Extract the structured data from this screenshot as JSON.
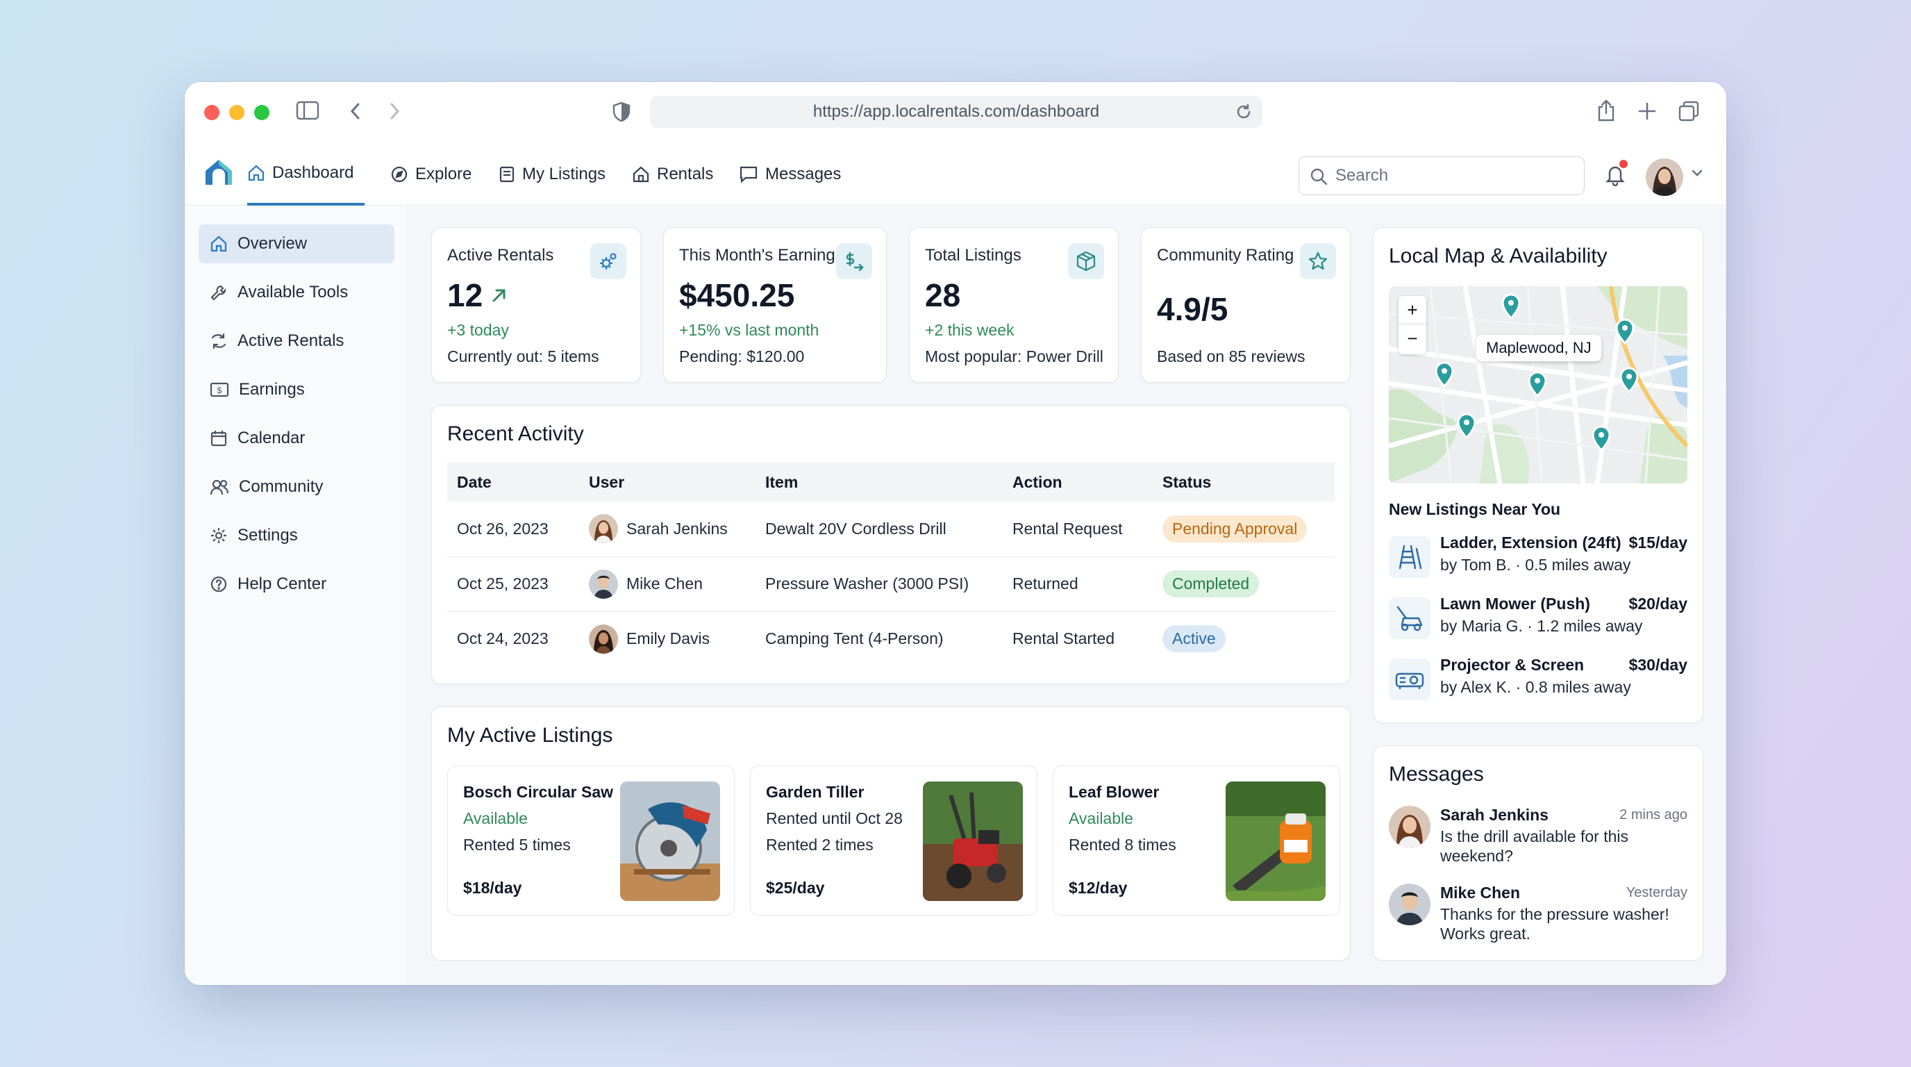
{
  "browser": {
    "url": "https://app.localrentals.com/dashboard"
  },
  "nav": {
    "items": [
      {
        "label": "Dashboard",
        "icon": "home-icon"
      },
      {
        "label": "Explore",
        "icon": "compass-icon"
      },
      {
        "label": "My Listings",
        "icon": "list-icon"
      },
      {
        "label": "Rentals",
        "icon": "house-icon"
      },
      {
        "label": "Messages",
        "icon": "chat-icon"
      }
    ],
    "search_placeholder": "Search"
  },
  "sidebar": {
    "items": [
      {
        "label": "Overview"
      },
      {
        "label": "Available Tools"
      },
      {
        "label": "Active Rentals"
      },
      {
        "label": "Earnings"
      },
      {
        "label": "Calendar"
      },
      {
        "label": "Community"
      },
      {
        "label": "Settings"
      },
      {
        "label": "Help Center"
      }
    ]
  },
  "stats": [
    {
      "label": "Active Rentals",
      "value": "12",
      "sub1": "+3 today",
      "sub2": "Currently out: 5 items"
    },
    {
      "label": "This Month's Earnings",
      "value": "$450.25",
      "sub1": "+15% vs last month",
      "sub2": "Pending: $120.00"
    },
    {
      "label": "Total Listings",
      "value": "28",
      "sub1": "+2 this week",
      "sub2": "Most popular: Power Drill"
    },
    {
      "label": "Community Rating",
      "value": "4.9/5",
      "sub2": "Based on 85 reviews"
    }
  ],
  "activity": {
    "title": "Recent Activity",
    "columns": [
      "Date",
      "User",
      "Item",
      "Action",
      "Status"
    ],
    "rows": [
      {
        "date": "Oct 26, 2023",
        "user": "Sarah Jenkins",
        "item": "Dewalt 20V Cordless Drill",
        "action": "Rental Request",
        "status": "Pending Approval"
      },
      {
        "date": "Oct 25, 2023",
        "user": "Mike Chen",
        "item": "Pressure Washer (3000 PSI)",
        "action": "Returned",
        "status": "Completed"
      },
      {
        "date": "Oct 24, 2023",
        "user": "Emily Davis",
        "item": "Camping Tent (4-Person)",
        "action": "Rental Started",
        "status": "Active"
      }
    ],
    "status_colors": {
      "Pending Approval": "#fce8cf",
      "Completed": "#d7f1dc",
      "Active": "#dbe9f7"
    }
  },
  "listings": {
    "title": "My Active Listings",
    "items": [
      {
        "name": "Bosch Circular Saw",
        "status": "Available",
        "rented": "Rented 5 times",
        "price": "$18/day"
      },
      {
        "name": "Garden Tiller",
        "status": "Rented until Oct 28",
        "rented": "Rented 2 times",
        "price": "$25/day"
      },
      {
        "name": "Leaf Blower",
        "status": "Available",
        "rented": "Rented 8 times",
        "price": "$12/day"
      }
    ]
  },
  "map": {
    "title": "Local Map & Availability",
    "tooltip": "Maplewood, NJ",
    "zoom_in": "+",
    "zoom_out": "−",
    "new_listings_title": "New Listings Near You",
    "new_listings": [
      {
        "name": "Ladder, Extension (24ft)",
        "meta": "by Tom B. · 0.5 miles away",
        "price": "$15/day",
        "icon": "ladder-icon"
      },
      {
        "name": "Lawn Mower (Push)",
        "meta": "by Maria G. · 1.2 miles away",
        "price": "$20/day",
        "icon": "lawn-mower-icon"
      },
      {
        "name": "Projector & Screen",
        "meta": "by Alex K. · 0.8 miles away",
        "price": "$30/day",
        "icon": "projector-icon"
      }
    ]
  },
  "messages": {
    "title": "Messages",
    "items": [
      {
        "name": "Sarah Jenkins",
        "time": "2 mins ago",
        "text": "Is the drill available for this weekend?"
      },
      {
        "name": "Mike Chen",
        "time": "Yesterday",
        "text": "Thanks for the pressure washer! Works great."
      }
    ]
  },
  "colors": {
    "accent": "#2b7bbf",
    "positive": "#2e8a5b",
    "pin": "#2a9d9f"
  }
}
